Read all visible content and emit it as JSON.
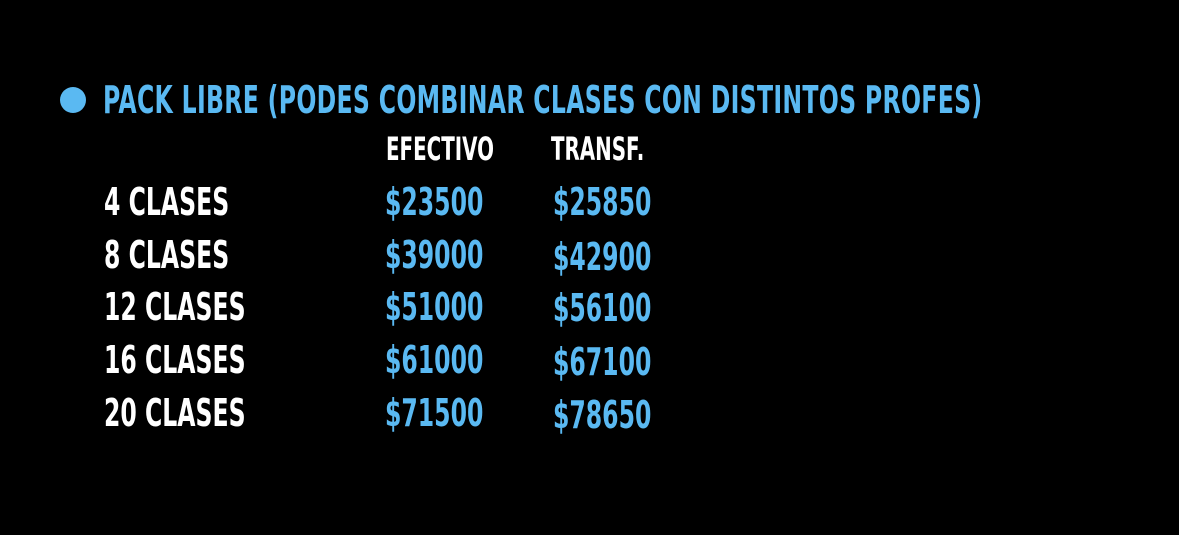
{
  "heading": {
    "bullet_color": "#5ab9f2",
    "title": "PACK LIBRE (PODES COMBINAR CLASES CON DISTINTOS PROFES)"
  },
  "columns": {
    "cash": "EFECTIVO",
    "transfer": "TRANSF."
  },
  "rows": [
    {
      "label": "4 CLASES",
      "cash": "$23500",
      "transfer": "$25850"
    },
    {
      "label": "8 CLASES",
      "cash": "$39000",
      "transfer": "$42900"
    },
    {
      "label": "12 CLASES",
      "cash": "$51000",
      "transfer": "$56100"
    },
    {
      "label": "16 CLASES",
      "cash": "$61000",
      "transfer": "$67100"
    },
    {
      "label": "20 CLASES",
      "cash": "$71500",
      "transfer": "$78650"
    }
  ],
  "colors": {
    "background": "#000000",
    "accent": "#5ab9f2",
    "text": "#ffffff"
  }
}
